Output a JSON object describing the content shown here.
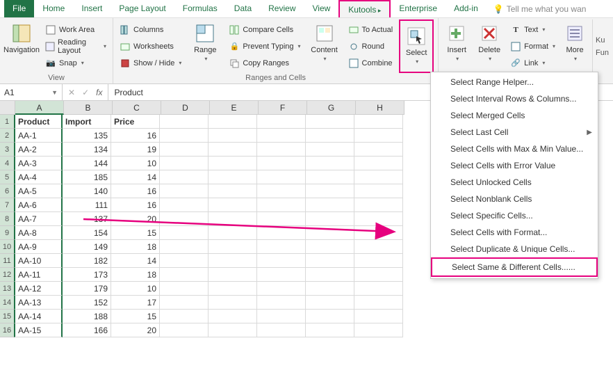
{
  "tabs": [
    "File",
    "Home",
    "Insert",
    "Page Layout",
    "Formulas",
    "Data",
    "Review",
    "View",
    "Kutools",
    "Enterprise",
    "Add-in"
  ],
  "active_tab_index": 8,
  "tellme": "Tell me what you wan",
  "ribbon": {
    "view": {
      "label": "View",
      "nav": "Navigation",
      "items": [
        "Work Area",
        "Reading Layout",
        "Snap"
      ]
    },
    "ranges": {
      "label": "Ranges and Cells",
      "range": "Range",
      "col": [
        "Columns",
        "Worksheets",
        "Show / Hide"
      ],
      "cmp": [
        "Compare Cells",
        "Prevent Typing",
        "Copy Ranges"
      ],
      "content": "Content",
      "actual": [
        "To Actual",
        "Round",
        "Combine"
      ],
      "select": "Select"
    },
    "edit": {
      "insert": "Insert",
      "delete": "Delete",
      "text": "Text",
      "format": "Format",
      "link": "Link",
      "more": "More",
      "ku": "Ku",
      "fun": "Fun"
    }
  },
  "namebox": "A1",
  "formula": "Product",
  "columns": [
    "A",
    "B",
    "C",
    "D",
    "E",
    "F",
    "G",
    "H"
  ],
  "chart_data": {
    "type": "table",
    "headers": [
      "Product",
      "Import",
      "Price"
    ],
    "rows": [
      [
        "AA-1",
        135,
        16
      ],
      [
        "AA-2",
        134,
        19
      ],
      [
        "AA-3",
        144,
        10
      ],
      [
        "AA-4",
        185,
        14
      ],
      [
        "AA-5",
        140,
        16
      ],
      [
        "AA-6",
        111,
        16
      ],
      [
        "AA-7",
        137,
        20
      ],
      [
        "AA-8",
        154,
        15
      ],
      [
        "AA-9",
        149,
        18
      ],
      [
        "AA-10",
        182,
        14
      ],
      [
        "AA-11",
        173,
        18
      ],
      [
        "AA-12",
        179,
        10
      ],
      [
        "AA-13",
        152,
        17
      ],
      [
        "AA-14",
        188,
        15
      ],
      [
        "AA-15",
        166,
        20
      ]
    ]
  },
  "dropdown": [
    "Select Range Helper...",
    "Select Interval Rows & Columns...",
    "Select Merged Cells",
    "Select Last Cell",
    "Select Cells with Max & Min Value...",
    "Select Cells with Error Value",
    "Select Unlocked Cells",
    "Select Nonblank Cells",
    "Select Specific Cells...",
    "Select Cells with Format...",
    "Select Duplicate & Unique Cells...",
    "Select Same & Different Cells......"
  ],
  "dropdown_submenu_index": 3,
  "dropdown_highlight_index": 11
}
